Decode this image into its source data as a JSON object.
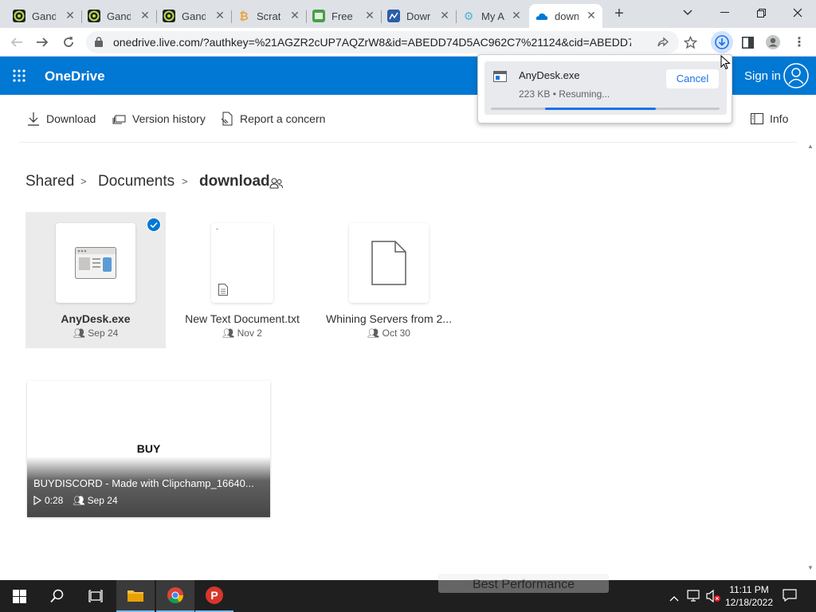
{
  "tabs": [
    {
      "title": "Gand",
      "icon": "gandalf-icon"
    },
    {
      "title": "Gand",
      "icon": "gandalf-icon"
    },
    {
      "title": "Gand",
      "icon": "gandalf-icon"
    },
    {
      "title": "Scrat",
      "icon": "scratch-icon"
    },
    {
      "title": "Free",
      "icon": "freebie-icon"
    },
    {
      "title": "Dowr",
      "icon": "download-site-icon"
    },
    {
      "title": "My A",
      "icon": "settings-icon"
    },
    {
      "title": "down",
      "icon": "onedrive-icon",
      "active": true
    }
  ],
  "address": {
    "url": "onedrive.live.com/?authkey=%21AGZR2cUP7AQZrW8&id=ABEDD74D5AC962C7%21124&cid=ABEDD74D5..."
  },
  "header": {
    "brand": "OneDrive",
    "signin": "Sign in"
  },
  "commands": {
    "download": "Download",
    "version_history": "Version history",
    "report": "Report a concern",
    "info": "Info"
  },
  "breadcrumb": {
    "shared": "Shared",
    "documents": "Documents",
    "current": "download"
  },
  "files": [
    {
      "name": "AnyDesk.exe",
      "date": "Sep 24",
      "selected": true
    },
    {
      "name": "New Text Document.txt",
      "date": "Nov 2"
    },
    {
      "name": "Whining Servers from 2...",
      "date": "Oct 30"
    }
  ],
  "video": {
    "thumb_text": "BUY",
    "name": "BUYDISCORD - Made with Clipchamp_16640...",
    "duration": "0:28",
    "date": "Sep 24"
  },
  "download_bubble": {
    "filename": "AnyDesk.exe",
    "status": "223 KB • Resuming...",
    "cancel": "Cancel",
    "progress": 0.72
  },
  "taskbar": {
    "time": "11:11 PM",
    "date": "12/18/2022",
    "ghost_text": "Best Performance"
  },
  "colors": {
    "onedrive_blue": "#0078d4",
    "taskbar": "#1f1f1f",
    "chrome_tabs": "#dee1e6"
  }
}
